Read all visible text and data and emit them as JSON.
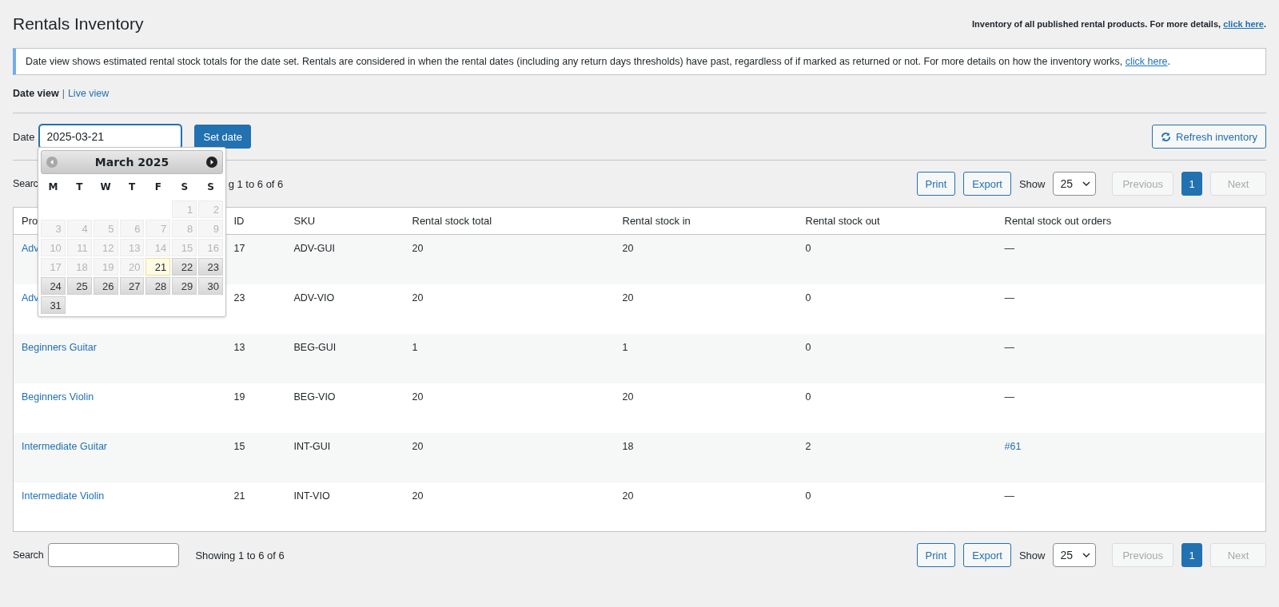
{
  "title": "Rentals Inventory",
  "header_note": {
    "text": "Inventory of all published rental products. For more details, ",
    "link": "click here",
    "end": "."
  },
  "notice": {
    "text": "Date view shows estimated rental stock totals for the date set. Rentals are considered in when the rental dates (including any return days thresholds) have past, regardless of if marked as returned or not. For more details on how the inventory works, ",
    "link": "click here",
    "end": "."
  },
  "views": [
    {
      "label": "Date view",
      "selected": true
    },
    {
      "label": "Live view",
      "selected": false
    }
  ],
  "view_separator": "|",
  "date_form": {
    "label": "Date",
    "value": "2025-03-21",
    "button": "Set date"
  },
  "refresh_button": "Refresh inventory",
  "calendar": {
    "month": "March 2025",
    "prev": {
      "disabled": true
    },
    "next": {
      "disabled": false
    },
    "weekdays": [
      "M",
      "T",
      "W",
      "T",
      "F",
      "S",
      "S"
    ],
    "weeks": [
      [
        {
          "kind": "blank"
        },
        {
          "kind": "blank"
        },
        {
          "kind": "blank"
        },
        {
          "kind": "blank"
        },
        {
          "kind": "blank"
        },
        {
          "kind": "day",
          "label": "1",
          "disabled": true,
          "today": false
        },
        {
          "kind": "day",
          "label": "2",
          "disabled": true,
          "today": false
        }
      ],
      [
        {
          "kind": "day",
          "label": "3",
          "disabled": true,
          "today": false
        },
        {
          "kind": "day",
          "label": "4",
          "disabled": true,
          "today": false
        },
        {
          "kind": "day",
          "label": "5",
          "disabled": true,
          "today": false
        },
        {
          "kind": "day",
          "label": "6",
          "disabled": true,
          "today": false
        },
        {
          "kind": "day",
          "label": "7",
          "disabled": true,
          "today": false
        },
        {
          "kind": "day",
          "label": "8",
          "disabled": true,
          "today": false
        },
        {
          "kind": "day",
          "label": "9",
          "disabled": true,
          "today": false
        }
      ],
      [
        {
          "kind": "day",
          "label": "10",
          "disabled": true,
          "today": false
        },
        {
          "kind": "day",
          "label": "11",
          "disabled": true,
          "today": false
        },
        {
          "kind": "day",
          "label": "12",
          "disabled": true,
          "today": false
        },
        {
          "kind": "day",
          "label": "13",
          "disabled": true,
          "today": false
        },
        {
          "kind": "day",
          "label": "14",
          "disabled": true,
          "today": false
        },
        {
          "kind": "day",
          "label": "15",
          "disabled": true,
          "today": false
        },
        {
          "kind": "day",
          "label": "16",
          "disabled": true,
          "today": false
        }
      ],
      [
        {
          "kind": "day",
          "label": "17",
          "disabled": true,
          "today": false
        },
        {
          "kind": "day",
          "label": "18",
          "disabled": true,
          "today": false
        },
        {
          "kind": "day",
          "label": "19",
          "disabled": true,
          "today": false
        },
        {
          "kind": "day",
          "label": "20",
          "disabled": true,
          "today": false
        },
        {
          "kind": "day",
          "label": "21",
          "disabled": false,
          "today": true
        },
        {
          "kind": "day",
          "label": "22",
          "disabled": false,
          "today": false
        },
        {
          "kind": "day",
          "label": "23",
          "disabled": false,
          "today": false
        }
      ],
      [
        {
          "kind": "day",
          "label": "24",
          "disabled": false,
          "today": false
        },
        {
          "kind": "day",
          "label": "25",
          "disabled": false,
          "today": false
        },
        {
          "kind": "day",
          "label": "26",
          "disabled": false,
          "today": false
        },
        {
          "kind": "day",
          "label": "27",
          "disabled": false,
          "today": false
        },
        {
          "kind": "day",
          "label": "28",
          "disabled": false,
          "today": false
        },
        {
          "kind": "day",
          "label": "29",
          "disabled": false,
          "today": false
        },
        {
          "kind": "day",
          "label": "30",
          "disabled": false,
          "today": false
        }
      ],
      [
        {
          "kind": "day",
          "label": "31",
          "disabled": false,
          "today": false
        }
      ]
    ]
  },
  "top_toolbar": {
    "search_label": "Searc",
    "status": "g 1 to 6 of 6",
    "print": "Print",
    "export": "Export",
    "show_label": "Show",
    "show_value": "25",
    "pages": [
      {
        "label": "Previous",
        "kind": "prev",
        "disabled": true,
        "selected": false
      },
      {
        "label": "1",
        "kind": "page",
        "disabled": false,
        "selected": true
      },
      {
        "label": "Next",
        "kind": "next",
        "disabled": true,
        "selected": false
      }
    ]
  },
  "table": {
    "columns": [
      "Pro",
      "ID",
      "SKU",
      "Rental stock total",
      "Rental stock in",
      "Rental stock out",
      "Rental stock out orders"
    ],
    "rows": [
      {
        "product": "Adv",
        "id": "17",
        "sku": "ADV-GUI",
        "total": "20",
        "in": "20",
        "out": "0",
        "orders": {
          "kind": "none",
          "text": "—"
        }
      },
      {
        "product": "Adv",
        "id": "23",
        "sku": "ADV-VIO",
        "total": "20",
        "in": "20",
        "out": "0",
        "orders": {
          "kind": "none",
          "text": "—"
        }
      },
      {
        "product": "Beginners Guitar",
        "id": "13",
        "sku": "BEG-GUI",
        "total": "1",
        "in": "1",
        "out": "0",
        "orders": {
          "kind": "none",
          "text": "—"
        }
      },
      {
        "product": "Beginners Violin",
        "id": "19",
        "sku": "BEG-VIO",
        "total": "20",
        "in": "20",
        "out": "0",
        "orders": {
          "kind": "none",
          "text": "—"
        }
      },
      {
        "product": "Intermediate Guitar",
        "id": "15",
        "sku": "INT-GUI",
        "total": "20",
        "in": "18",
        "out": "2",
        "orders": {
          "kind": "link",
          "text": "#61"
        }
      },
      {
        "product": "Intermediate Violin",
        "id": "21",
        "sku": "INT-VIO",
        "total": "20",
        "in": "20",
        "out": "0",
        "orders": {
          "kind": "none",
          "text": "—"
        }
      }
    ]
  },
  "bottom_toolbar": {
    "search_label": "Search",
    "status": "Showing 1 to 6 of 6",
    "print": "Print",
    "export": "Export",
    "show_label": "Show",
    "show_value": "25",
    "pages": [
      {
        "label": "Previous",
        "kind": "prev",
        "disabled": true,
        "selected": false
      },
      {
        "label": "1",
        "kind": "page",
        "disabled": false,
        "selected": true
      },
      {
        "label": "Next",
        "kind": "next",
        "disabled": true,
        "selected": false
      }
    ]
  }
}
